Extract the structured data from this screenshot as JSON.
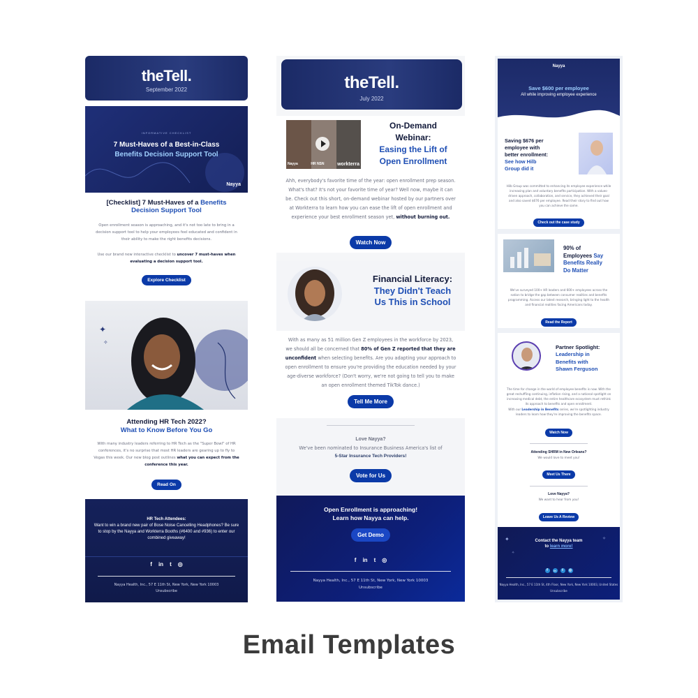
{
  "caption": "Email Templates",
  "template1": {
    "header": {
      "logo": "theTell.",
      "date": "September 2022"
    },
    "hero": {
      "kicker": "INFORMATIVE CHECKLIST",
      "title_line1": "7 Must-Haves of a Best-in-Class",
      "title_line2": "Benefits Decision Support Tool",
      "brand": "Nayya"
    },
    "article1": {
      "title_dark": "[Checklist] 7 Must-Haves of a",
      "title_blue_inline": "Benefits",
      "title_blue": "Decision Support Tool",
      "body1": "Open enrollment season is approaching, and it's not too late to bring in a decision support tool to help your employees feel educated and confident in their ability to make the right benefits decisions.",
      "body2_pre": "Use our brand new interactive checklist to",
      "body2_bold": "uncover 7 must-haves when evaluating a decision support tool.",
      "button": "Explore Checklist"
    },
    "article2": {
      "title_dark": "Attending HR Tech 2022?",
      "title_blue": "What to Know Before You Go",
      "body_pre": "With many industry leaders referring to HR Tech as the \"Super Bowl\" of HR conferences, it's no surprise that most HR leaders are gearing up to fly to Vegas this week. Our new blog post outlines",
      "body_bold": "what you can expect from the conference this year.",
      "button": "Read On"
    },
    "promo": {
      "title": "HR Tech Attendees:",
      "body": "Want to win a brand new pair of Bose Noise Cancelling Headphones? Be sure to stop by the Nayya and Workterra Booths (#6400 and #936) to enter our combined giveaway!"
    },
    "social": [
      "f",
      "in",
      "t",
      "◎"
    ],
    "footer": {
      "address": "Nayya Health, Inc., 57 E 11th St, New York, New York 10003",
      "unsubscribe": "Unsubscribe"
    }
  },
  "template2": {
    "header": {
      "logo": "theTell.",
      "date": "July 2022"
    },
    "video": {
      "tags": [
        "Nayya",
        "HR NSN",
        "workterra"
      ]
    },
    "webinar": {
      "title_line1": "On-Demand",
      "title_line2": "Webinar:",
      "title_blue1": "Easing the Lift of",
      "title_blue2": "Open Enrollment",
      "body_pre": "Ahh, everybody's favorite time of the year: open enrollment prep season. What's that? It's not your favorite time of year? Well now, maybe it can be. Check out this short, on-demand webinar hosted by our partners over at Workterra to learn how you can ease the lift of open enrollment and experience your best enrollment season yet,",
      "body_bold": "without burning out.",
      "button": "Watch Now"
    },
    "literacy": {
      "title_dark": "Financial Literacy:",
      "title_blue1": "They Didn't Teach",
      "title_blue2": "Us This in School",
      "body_pre": "With as many as 51 million Gen Z employees in the workforce by 2023, we should all be concerned that",
      "body_bold": "80% of Gen Z reported that they are unconfident",
      "body_post": "when selecting benefits. Are you adapting your approach to open enrollment to ensure you're providing the education needed by your age-diverse workforce? (Don't worry, we're not going to tell you to make an open enrollment themed TikTok dance.)",
      "button": "Tell Me More"
    },
    "vote": {
      "title": "Love Nayya?",
      "body1": "We've been nominated to Insurance Business America's list of",
      "body2": "5-Star Insurance Tech Providers!",
      "button": "Vote for Us"
    },
    "cta": {
      "line1": "Open Enrollment is approaching!",
      "line2": "Learn how Nayya can help.",
      "button": "Get Demo"
    },
    "social": [
      "f",
      "in",
      "t",
      "◎"
    ],
    "footer": {
      "address": "Nayya Health, Inc., 57 E 11th St, New York, New York 10003",
      "unsubscribe": "Unsubscribe"
    }
  },
  "template3": {
    "header": {
      "brand": "Nayya",
      "headline": "Save $600 per employee",
      "subline": "All while improving employee experience"
    },
    "case": {
      "title_dark1": "Saving $676 per",
      "title_dark2": "employee with",
      "title_dark3": "better enrollment:",
      "title_blue1": "See how Hilb",
      "title_blue2": "Group did it",
      "body": "Hilb Group was committed to enhancing its employee experience while increasing plan and voluntary benefits participation. With a values-driven approach, collaboration, and service, they achieved their goal and also saved $676 per employee. Read their story to find out how you can achieve the same.",
      "button": "Check out the case study"
    },
    "report": {
      "title_dark1": "90% of",
      "title_dark2": "Employees",
      "title_blue_inline": "Say",
      "title_blue1": "Benefits Really",
      "title_blue2": "Do Matter",
      "body": "We've surveyed 100+ HR leaders and 600+ employees across the nation to bridge the gap between consumer realities and benefits programming. Access our latest research, bringing light to the health and financial realities facing Americans today.",
      "button": "Read the Report"
    },
    "partner": {
      "title_dark": "Partner Spotlight:",
      "title_blue1": "Leadership in",
      "title_blue2": "Benefits with",
      "title_blue3": "Shawn Ferguson",
      "body": "The time for change in the world of employee benefits is now. With the great reshuffling continuing, inflation rising, and a national spotlight on increasing medical debt, the entire healthcare ecosystem must rethink its approach to benefits and open enrollment.",
      "body2_pre": "With our",
      "body2_bold": "Leadership in Benefits",
      "body2_post": "series, we're spotlighting industry leaders to learn how they're improving the benefits space.",
      "button": "Watch Now"
    },
    "shrm": {
      "title": "Attending SHRM in New Orleans?",
      "body": "We would love to meet you!",
      "button": "Meet Us There"
    },
    "review": {
      "title": "Love Nayya?",
      "body": "We want to hear from you!",
      "button": "Leave Us A Review"
    },
    "contact": {
      "line1": "Contact the Nayya team",
      "line2_pre": "to",
      "line2_link": "learn more!"
    },
    "social": [
      "f",
      "in",
      "t",
      "◎"
    ],
    "footer": {
      "address": "Nayya Health, Inc., 57 E 11th St, 4th Floor, New York, New York 10003, United States",
      "unsubscribe": "Unsubscribe"
    }
  }
}
